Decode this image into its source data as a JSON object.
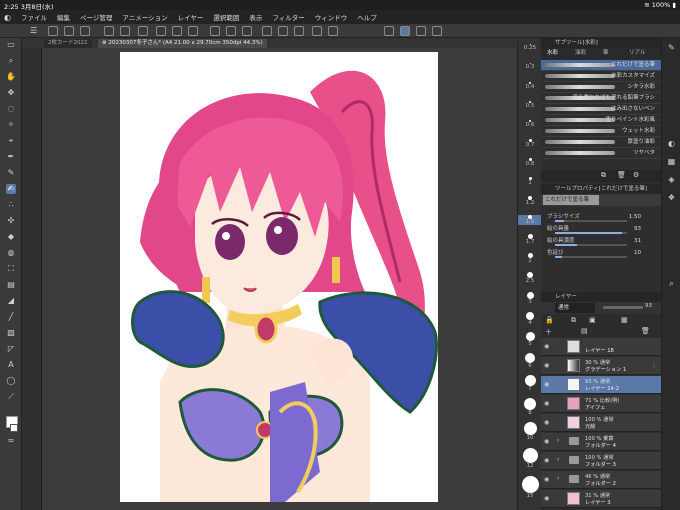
{
  "status_bar": {
    "time": "2:25",
    "date": "3月8日(水)",
    "battery": "100%"
  },
  "menu": [
    "ファイル",
    "編集",
    "ページ管理",
    "アニメーション",
    "レイヤー",
    "選択範囲",
    "表示",
    "フィルター",
    "ウィンドウ",
    "ヘルプ"
  ],
  "tabs": [
    {
      "label": "2枚カード2022",
      "active": false
    },
    {
      "label": "20230307冬子さん* (A4 21.00 x 29.70cm 350dpi 44.3%)",
      "active": true
    }
  ],
  "brush_sizes": [
    "0.25",
    "0.3",
    "0.4",
    "0.5",
    "0.6",
    "0.7",
    "0.8",
    "1",
    "1.2",
    "1.5",
    "1.7",
    "2",
    "2.5",
    "3",
    "4",
    "5",
    "6",
    "7",
    "8",
    "10",
    "12",
    "15"
  ],
  "sub_tool_panel": {
    "title": "サブツール[水彩]",
    "tabs": [
      "水彩",
      "油彩",
      "筆",
      "リアル"
    ],
    "brushes": [
      {
        "name": "これだけで塗る筆",
        "selected": true
      },
      {
        "name": "水彩カスタマイズ",
        "selected": false
      },
      {
        "name": "シタラ水彩",
        "selected": false
      },
      {
        "name": "塗り重ねればも塗れる鉛筆ブラシ",
        "selected": false
      },
      {
        "name": "はみ出さないペン",
        "selected": false
      },
      {
        "name": "塗りペイント水彩風",
        "selected": false
      },
      {
        "name": "ウェット水彩",
        "selected": false
      },
      {
        "name": "厚塗り油彩",
        "selected": false
      },
      {
        "name": "ツヤベタ",
        "selected": false
      }
    ]
  },
  "tool_property": {
    "title": "ツールプロパティ[これだけで塗る筆]",
    "preset": "これだけで塗る筆",
    "rows": [
      {
        "label": "ブラシサイズ",
        "value": "1.50",
        "fill": 0.12
      },
      {
        "label": "絵の具量",
        "value": "93",
        "fill": 0.93
      },
      {
        "label": "絵の具濃度",
        "value": "31",
        "fill": 0.31
      },
      {
        "label": "色延び",
        "value": "10",
        "fill": 0.1
      }
    ]
  },
  "layer_panel": {
    "title": "レイヤー",
    "blend_mode": "通常",
    "opacity": "93",
    "layers": [
      {
        "line1": "",
        "line2": "レイヤー 18",
        "kind": "layer",
        "selected": false
      },
      {
        "line1": "30 % 通常",
        "line2": "グラデーション 1",
        "kind": "layer",
        "selected": false
      },
      {
        "line1": "93 % 通常",
        "line2": "レイヤー 14-2",
        "kind": "layer",
        "selected": true
      },
      {
        "line1": "71 % 比較(明)",
        "line2": "アイフェ",
        "kind": "layer",
        "selected": false
      },
      {
        "line1": "100 % 通常",
        "line2": "元絵",
        "kind": "layer",
        "selected": false
      },
      {
        "line1": "100 % 乗算",
        "line2": "フォルダー 4",
        "kind": "folder",
        "selected": false
      },
      {
        "line1": "100 % 通常",
        "line2": "フォルダー 3",
        "kind": "folder",
        "selected": false
      },
      {
        "line1": "46 % 通常",
        "line2": "フォルダー 2",
        "kind": "folder",
        "selected": false
      },
      {
        "line1": "31 % 通常",
        "line2": "レイヤー 3",
        "kind": "layer",
        "selected": false
      }
    ]
  }
}
